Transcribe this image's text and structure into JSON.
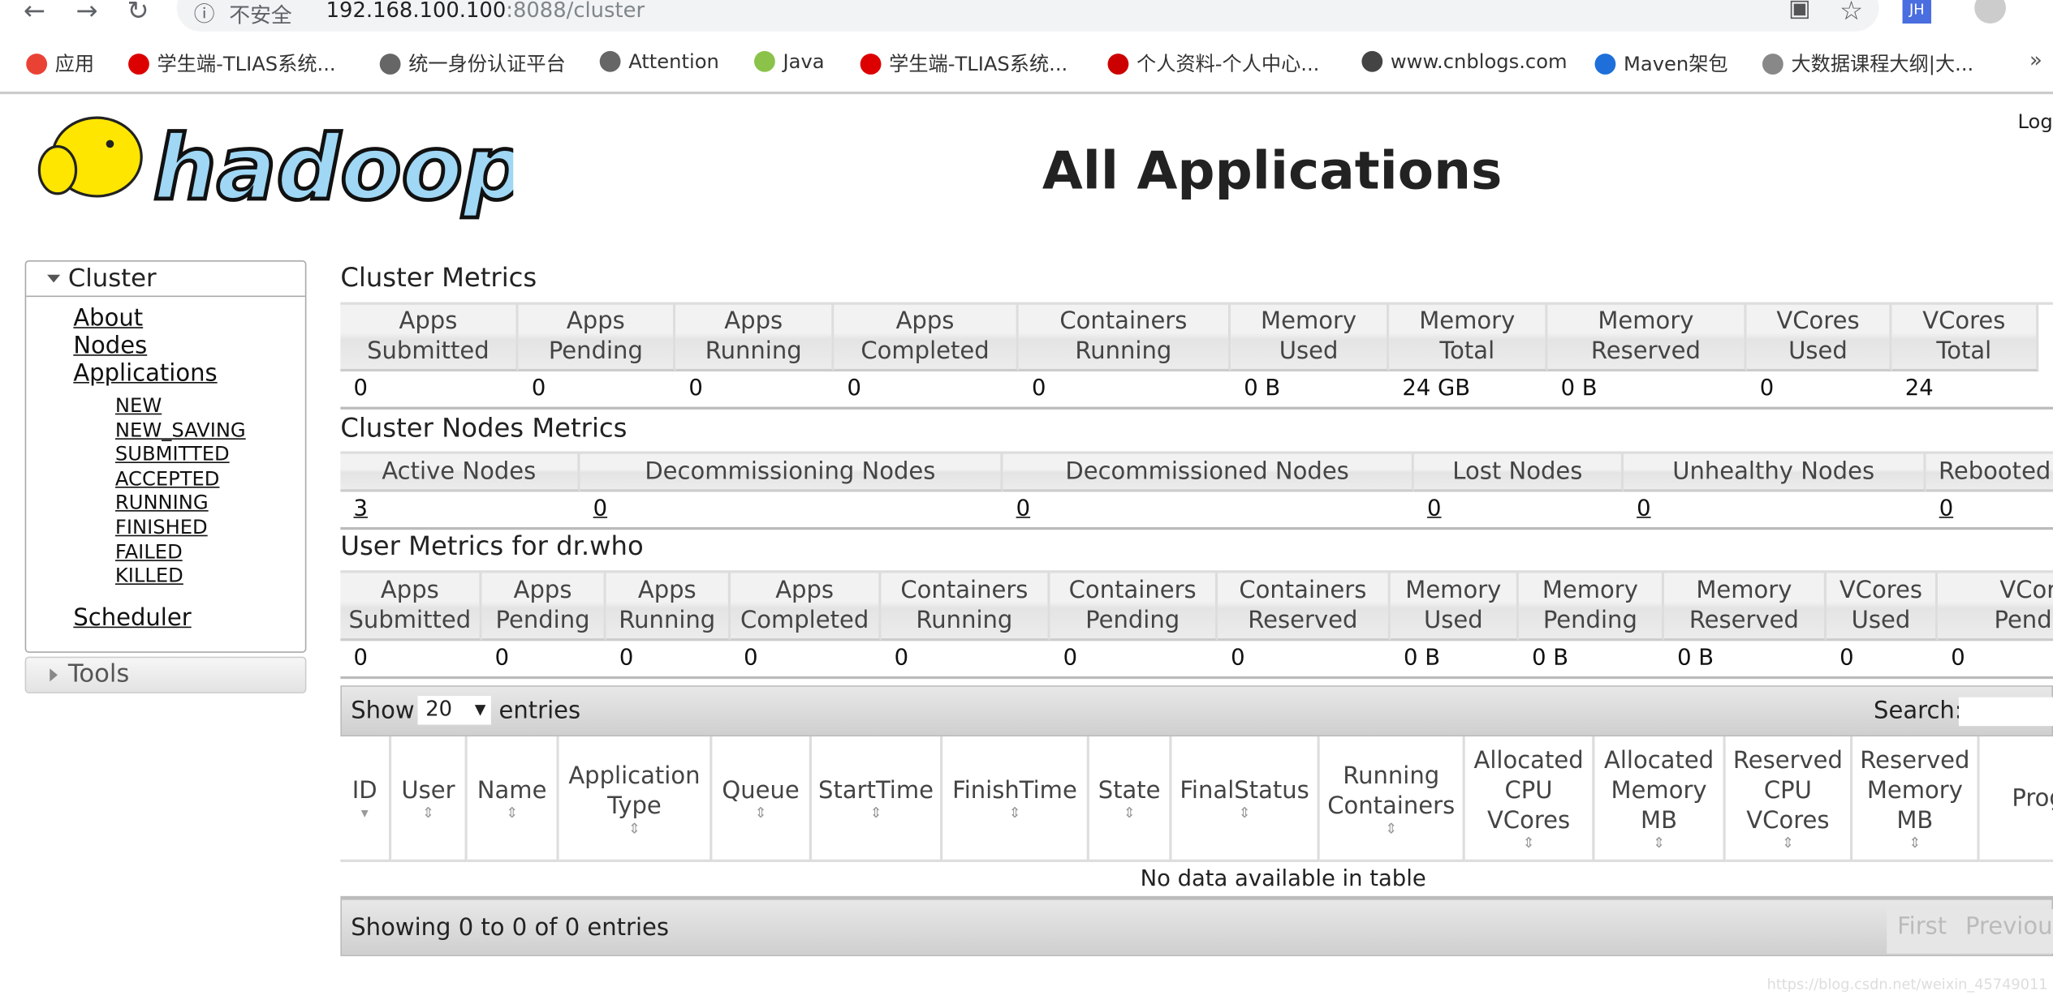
{
  "browser": {
    "security": "不安全",
    "url_host": "192.168.100.100",
    "url_rest": ":8088/cluster",
    "profile": "JH",
    "bookmarks": [
      {
        "label": "应用",
        "color": "#e94235"
      },
      {
        "label": "学生端-TLIAS系统...",
        "color": "#d00"
      },
      {
        "label": "统一身份认证平台",
        "color": "#666"
      },
      {
        "label": "Attention",
        "color": "#666"
      },
      {
        "label": "Java",
        "color": "#8bc34a"
      },
      {
        "label": "学生端-TLIAS系统...",
        "color": "#d00"
      },
      {
        "label": "个人资料-个人中心...",
        "color": "#c00"
      },
      {
        "label": "www.cnblogs.com",
        "color": "#444"
      },
      {
        "label": "Maven架包",
        "color": "#1e6fd9"
      },
      {
        "label": "大数据课程大纲|大...",
        "color": "#888"
      }
    ]
  },
  "header": {
    "title": "All Applications",
    "logo_text": "hadoop",
    "login": "Log"
  },
  "sidebar": {
    "cluster": "Cluster",
    "items": [
      "About",
      "Nodes",
      "Applications"
    ],
    "states": [
      "NEW",
      "NEW_SAVING",
      "SUBMITTED",
      "ACCEPTED",
      "RUNNING",
      "FINISHED",
      "FAILED",
      "KILLED"
    ],
    "scheduler": "Scheduler",
    "tools": "Tools"
  },
  "cluster_metrics": {
    "title": "Cluster Metrics",
    "headers": [
      "Apps\nSubmitted",
      "Apps\nPending",
      "Apps\nRunning",
      "Apps\nCompleted",
      "Containers\nRunning",
      "Memory\nUsed",
      "Memory\nTotal",
      "Memory\nReserved",
      "VCores\nUsed",
      "VCores\nTotal"
    ],
    "values": [
      "0",
      "0",
      "0",
      "0",
      "0",
      "0 B",
      "24 GB",
      "0 B",
      "0",
      "24"
    ]
  },
  "nodes_metrics": {
    "title": "Cluster Nodes Metrics",
    "headers": [
      "Active Nodes",
      "Decommissioning Nodes",
      "Decommissioned Nodes",
      "Lost Nodes",
      "Unhealthy Nodes",
      "Rebooted Nodes"
    ],
    "values": [
      "3",
      "0",
      "0",
      "0",
      "0",
      "0"
    ]
  },
  "user_metrics": {
    "title": "User Metrics for dr.who",
    "headers": [
      "Apps\nSubmitted",
      "Apps\nPending",
      "Apps\nRunning",
      "Apps\nCompleted",
      "Containers\nRunning",
      "Containers\nPending",
      "Containers\nReserved",
      "Memory\nUsed",
      "Memory\nPending",
      "Memory\nReserved",
      "VCores\nUsed",
      "VCores\nPending"
    ],
    "values": [
      "0",
      "0",
      "0",
      "0",
      "0",
      "0",
      "0",
      "0 B",
      "0 B",
      "0 B",
      "0",
      "0"
    ]
  },
  "apps_table": {
    "show": "Show",
    "entries": "entries",
    "page_size": "20",
    "search_label": "Search:",
    "search_value": "",
    "columns": [
      "ID",
      "User",
      "Name",
      "Application\nType",
      "Queue",
      "StartTime",
      "FinishTime",
      "State",
      "FinalStatus",
      "Running\nContainers",
      "Allocated\nCPU\nVCores",
      "Allocated\nMemory\nMB",
      "Reserved\nCPU\nVCores",
      "Reserved\nMemory\nMB",
      "Progress"
    ],
    "empty": "No data available in table",
    "info": "Showing 0 to 0 of 0 entries",
    "first": "First",
    "previous": "Previous"
  },
  "watermark": "https://blog.csdn.net/weixin_45749011"
}
